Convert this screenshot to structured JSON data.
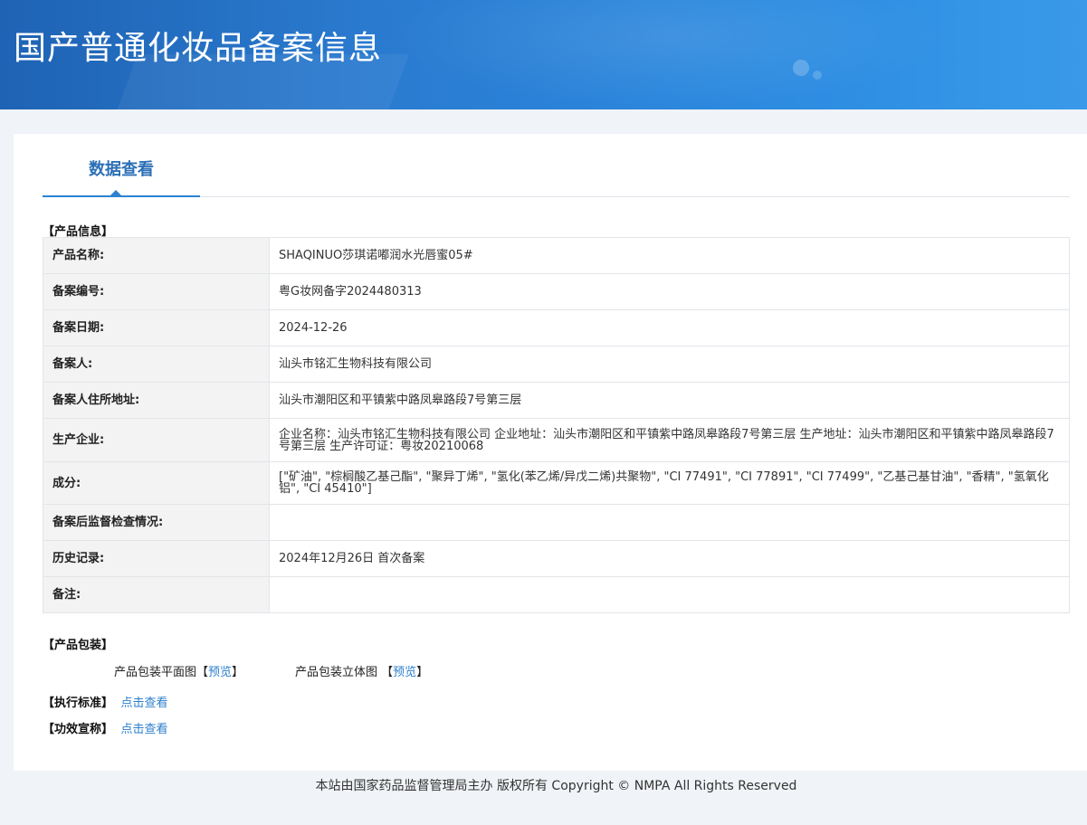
{
  "header": {
    "title": "国产普通化妆品备案信息"
  },
  "tab": {
    "label": "数据查看"
  },
  "product_info": {
    "section_label": "【产品信息】",
    "rows": [
      {
        "key": "产品名称:",
        "value": "SHAQINUO莎琪诺嘟润水光唇蜜05#"
      },
      {
        "key": "备案编号:",
        "value": "粤G妆网备字2024480313"
      },
      {
        "key": "备案日期:",
        "value": "2024-12-26"
      },
      {
        "key": "备案人:",
        "value": "汕头市铭汇生物科技有限公司"
      },
      {
        "key": "备案人住所地址:",
        "value": "汕头市潮阳区和平镇紫中路凤皋路段7号第三层"
      },
      {
        "key": "生产企业:",
        "value": "企业名称：汕头市铭汇生物科技有限公司 企业地址：汕头市潮阳区和平镇紫中路凤皋路段7号第三层 生产地址：汕头市潮阳区和平镇紫中路凤皋路段7号第三层 生产许可证：粤妆20210068"
      },
      {
        "key": "成分:",
        "value": "[\"矿油\", \"棕榈酸乙基己酯\", \"聚异丁烯\", \"氢化(苯乙烯/异戊二烯)共聚物\", \"CI 77491\", \"CI 77891\", \"CI 77499\", \"乙基己基甘油\", \"香精\", \"氢氧化铝\", \"CI 45410\"]"
      },
      {
        "key": "备案后监督检查情况:",
        "value": ""
      },
      {
        "key": "历史记录:",
        "value": "2024年12月26日 首次备案"
      },
      {
        "key": "备注:",
        "value": ""
      }
    ]
  },
  "packaging": {
    "section_label": "【产品包装】",
    "flat_label": "产品包装平面图",
    "flat_link": "预览",
    "solid_label": "产品包装立体图",
    "solid_link": "预览"
  },
  "standard": {
    "label": "【执行标准】",
    "link": "点击查看"
  },
  "efficacy": {
    "label": "【功效宣称】",
    "link": "点击查看"
  },
  "footer": {
    "text": "本站由国家药品监督管理局主办 版权所有 Copyright © NMPA All Rights Reserved"
  }
}
